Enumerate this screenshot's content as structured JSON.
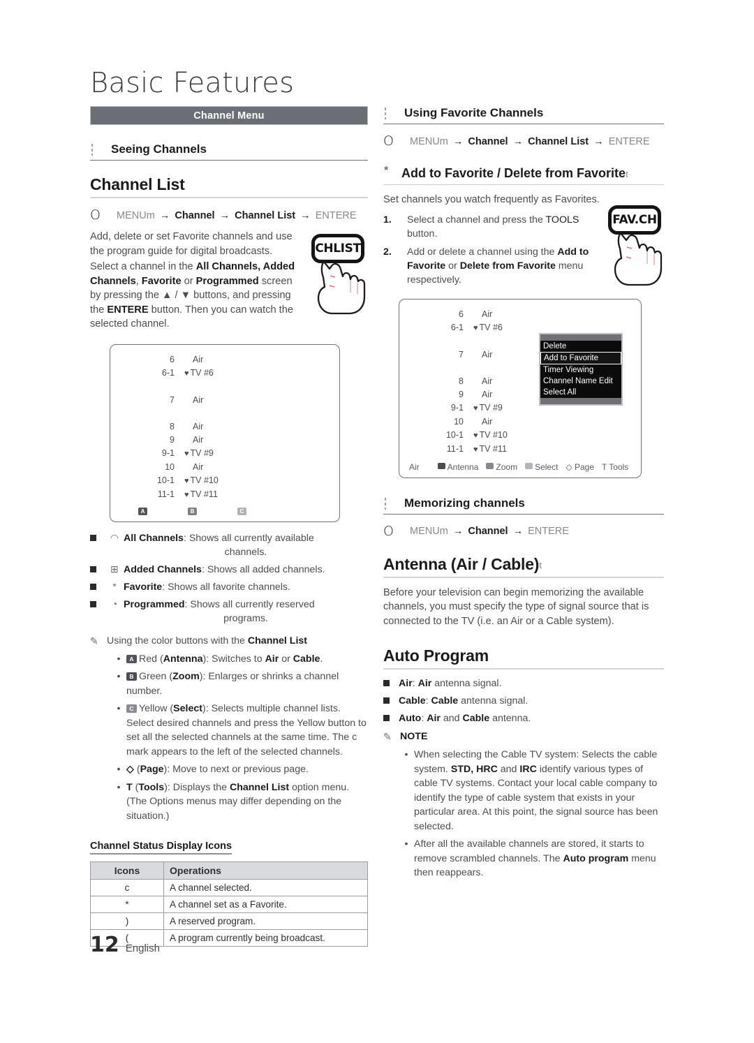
{
  "page": {
    "title": "Basic Features",
    "footer_page": "12",
    "footer_lang": "English"
  },
  "banner": {
    "label": "Channel Menu"
  },
  "left": {
    "seeing_channels": {
      "heading": "Seeing Channels"
    },
    "channel_list": {
      "heading": "Channel List",
      "path": {
        "menu": "MENU",
        "menu_sup": "m",
        "channel": "Channel",
        "list": "Channel List",
        "enter": "ENTER",
        "enter_sup": "E",
        "arrow": "→"
      },
      "para1": "Add, delete or set Favorite channels and use the program guide for digital broadcasts.",
      "para2_pre": "Select a channel in the ",
      "para2_b1": "All Channels, Added Channels",
      "para2_mid1": ", ",
      "para2_b2": "Favorite",
      "para2_mid2": " or ",
      "para2_b3": "Programmed",
      "para2_mid3": " screen by pressing the ▲ / ▼ buttons, and pressing the ",
      "para2_b4": "ENTER",
      "para2_sup": "E",
      "para2_end": " button. Then you can watch the selected channel."
    },
    "remote": {
      "label": "CHLIST"
    },
    "tv_rows": [
      {
        "num": "6",
        "name": "Air",
        "fav": false
      },
      {
        "num": "6-1",
        "name": "TV #6",
        "fav": true
      },
      {
        "num": "",
        "name": "",
        "gap": true
      },
      {
        "num": "7",
        "name": "Air",
        "fav": false
      },
      {
        "num": "",
        "name": "",
        "gap": true
      },
      {
        "num": "8",
        "name": "Air",
        "fav": false
      },
      {
        "num": "9",
        "name": "Air",
        "fav": false
      },
      {
        "num": "9-1",
        "name": "TV #9",
        "fav": true
      },
      {
        "num": "10",
        "name": "Air",
        "fav": false
      },
      {
        "num": "10-1",
        "name": "TV #10",
        "fav": true
      },
      {
        "num": "11-1",
        "name": "TV #11",
        "fav": true
      }
    ],
    "tv_colorkeys": [
      "A",
      "B",
      "C"
    ],
    "list_modes": [
      {
        "icon": "satellite-dish-icon",
        "glyph": "◠",
        "name": "All Channels",
        "desc": ": Shows all currently available",
        "desc2": "channels."
      },
      {
        "icon": "grid-plus-icon",
        "glyph": "⊞",
        "name": "Added Channels",
        "desc": ": Shows all added channels.",
        "desc2": ""
      },
      {
        "icon": "asterisk-icon",
        "glyph": "*",
        "name": "Favorite",
        "desc": ": Shows all favorite channels.",
        "desc2": ""
      },
      {
        "icon": "clock-icon",
        "glyph": "◔",
        "name": "Programmed",
        "desc": ": Shows all currently reserved",
        "desc2": "programs."
      }
    ],
    "color_note": {
      "pre": "Using the color buttons with the ",
      "bold": "Channel List"
    },
    "color_items": [
      {
        "key": "A",
        "key_class": "a",
        "pre": "Red (",
        "b1": "Antenna",
        "mid": "): Switches to ",
        "b2": "Air",
        "mid2": " or ",
        "b3": "Cable",
        "end": "."
      },
      {
        "key": "B",
        "key_class": "b",
        "pre": "Green (",
        "b1": "Zoom",
        "mid": "): Enlarges or shrinks a channel number.",
        "b2": "",
        "mid2": "",
        "b3": "",
        "end": ""
      },
      {
        "key": "C",
        "key_class": "c",
        "pre": "Yellow (",
        "b1": "Select",
        "mid": "): Selects multiple channel lists. Select desired channels and press the Yellow button to set all the selected channels at the same time. The c mark appears to the left of the selected channels.",
        "b2": "",
        "mid2": "",
        "b3": "",
        "end": ""
      }
    ],
    "page_item": {
      "glyph": "◇",
      "pre": " (",
      "b1": "Page",
      "end": "): Move to next or previous page."
    },
    "tools_item": {
      "glyph": "T",
      "pre": "  (",
      "b1": "Tools",
      "mid": "): Displays the ",
      "b2": "Channel List",
      "end": " option menu. (The Options menus may differ depending on the situation.)"
    },
    "icons_table": {
      "caption": "Channel Status Display Icons",
      "headers": [
        "Icons",
        "Operations"
      ],
      "rows": [
        {
          "icon": "c",
          "op": "A channel selected."
        },
        {
          "icon": "*",
          "op": "A channel set as a Favorite."
        },
        {
          "icon": ")",
          "op": "A reserved program."
        },
        {
          "icon": "(",
          "op": "A program currently being broadcast."
        }
      ]
    }
  },
  "right": {
    "using_fav": {
      "heading": "Using Favorite Channels",
      "path": {
        "menu": "MENU",
        "menu_sup": "m",
        "channel": "Channel",
        "list": "Channel List",
        "enter": "ENTER",
        "enter_sup": "E",
        "arrow": "→"
      }
    },
    "add_fav": {
      "star": "*",
      "heading": "Add to Favorite / Delete from Favorite",
      "heading_sup": "t",
      "intro": "Set channels you watch frequently as Favorites.",
      "steps": [
        {
          "n": "1.",
          "pre": "Select a channel and press the ",
          "b1": "TOOLS",
          "b1_plain": true,
          "end": " button."
        },
        {
          "n": "2.",
          "pre": "Add or delete a channel using the ",
          "b1": "Add to Favorite",
          "mid": " or ",
          "b2": "Delete from Favorite",
          "end": " menu respectively."
        }
      ]
    },
    "remote": {
      "label": "FAV.CH"
    },
    "tv_rows": [
      {
        "num": "6",
        "name": "Air",
        "fav": false
      },
      {
        "num": "6-1",
        "name": "TV #6",
        "fav": true
      },
      {
        "num": "",
        "name": "",
        "gap": true
      },
      {
        "num": "7",
        "name": "Air",
        "fav": false
      },
      {
        "num": "",
        "name": "",
        "gap": true
      },
      {
        "num": "8",
        "name": "Air",
        "fav": false
      },
      {
        "num": "9",
        "name": "Air",
        "fav": false
      },
      {
        "num": "9-1",
        "name": "TV #9",
        "fav": true
      },
      {
        "num": "10",
        "name": "Air",
        "fav": false
      },
      {
        "num": "10-1",
        "name": "TV #10",
        "fav": true
      },
      {
        "num": "11-1",
        "name": "TV #11",
        "fav": true
      }
    ],
    "popup_items": [
      {
        "label": "Delete",
        "selected": false
      },
      {
        "label": "Add to Favorite",
        "selected": true
      },
      {
        "label": "Timer Viewing",
        "selected": false
      },
      {
        "label": "Channel Name Edit",
        "selected": false
      },
      {
        "label": "Select All",
        "selected": false
      }
    ],
    "tv_footbar": {
      "source": "Air",
      "items": [
        {
          "key_class": "a",
          "label": "Antenna"
        },
        {
          "key_class": "b",
          "label": "Zoom"
        },
        {
          "key_class": "c",
          "label": "Select"
        }
      ],
      "page_glyph": "◇",
      "page_label": "Page",
      "tools_glyph": "T",
      "tools_label": "Tools"
    },
    "memorizing": {
      "heading": "Memorizing channels",
      "path": {
        "menu": "MENU",
        "menu_sup": "m",
        "channel": "Channel",
        "enter": "ENTER",
        "enter_sup": "E",
        "arrow": "→"
      }
    },
    "antenna": {
      "heading": "Antenna (Air / Cable)",
      "heading_sup": "t",
      "para": "Before your television can begin memorizing the available channels, you must specify the type of signal source that is connected to the TV (i.e. an Air or a Cable system)."
    },
    "auto_program": {
      "heading": "Auto Program",
      "items": [
        {
          "b1": "Air",
          "sep": ": ",
          "b2": "Air",
          "tail": " antenna signal."
        },
        {
          "b1": "Cable",
          "sep": ": ",
          "b2": "Cable",
          "tail": " antenna signal."
        },
        {
          "b1": "Auto",
          "sep": ": ",
          "b2": "Air",
          "mid": " and ",
          "b3": "Cable",
          "tail": " antenna."
        }
      ],
      "note_label": "NOTE",
      "notes": [
        {
          "pre": "When selecting the Cable TV system: Selects the cable system. ",
          "b1": "STD, HRC",
          "mid": " and ",
          "b2": "IRC",
          "end": " identify various types of cable TV systems. Contact your local cable company to identify the type of cable system that exists in your particular area. At this point, the signal source has been selected."
        },
        {
          "pre": "After all the available channels are stored, it starts to remove scrambled channels. The ",
          "b1": "Auto program",
          "end": " menu then reappears."
        }
      ]
    }
  }
}
